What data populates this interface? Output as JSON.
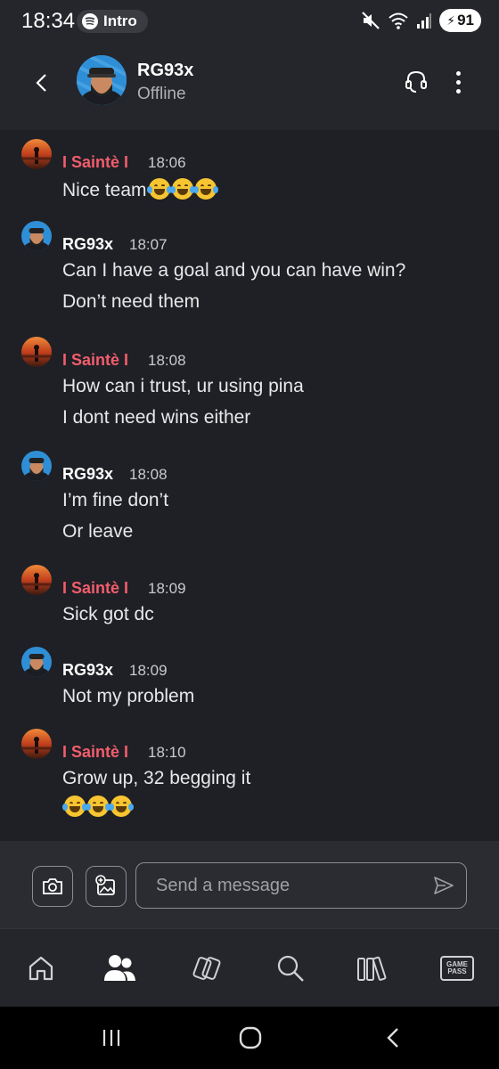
{
  "status_bar": {
    "time": "18:34",
    "pill_label": "Intro",
    "battery": "91"
  },
  "header": {
    "contact_name": "RG93x",
    "contact_status": "Offline"
  },
  "messages": [
    {
      "sender": "I Saintè I",
      "time": "18:06",
      "lines": [
        "Nice team"
      ],
      "emoji_count": 3
    },
    {
      "sender": "RG93x",
      "time": "18:07",
      "lines": [
        "Can I have a goal and you can have win?",
        "Don’t need them"
      ]
    },
    {
      "sender": "I Saintè I",
      "time": "18:08",
      "lines": [
        "How can i trust, ur using pina",
        "I dont need wins either"
      ]
    },
    {
      "sender": "RG93x",
      "time": "18:08",
      "lines": [
        "I’m fine don’t",
        "Or leave"
      ]
    },
    {
      "sender": "I Saintè I",
      "time": "18:09",
      "lines": [
        "Sick got dc"
      ]
    },
    {
      "sender": "RG93x",
      "time": "18:09",
      "lines": [
        "Not my problem"
      ]
    },
    {
      "sender": "I Saintè I",
      "time": "18:10",
      "lines": [
        "Grow up, 32 begging it"
      ],
      "emoji_count": 3
    }
  ],
  "composer": {
    "placeholder": "Send a message"
  },
  "bottom_nav": {
    "game_pass_label_1": "GAME",
    "game_pass_label_2": "PASS"
  },
  "colors": {
    "sender_pink": "#f25d6d",
    "background": "#1f2025",
    "header": "#24262b"
  }
}
